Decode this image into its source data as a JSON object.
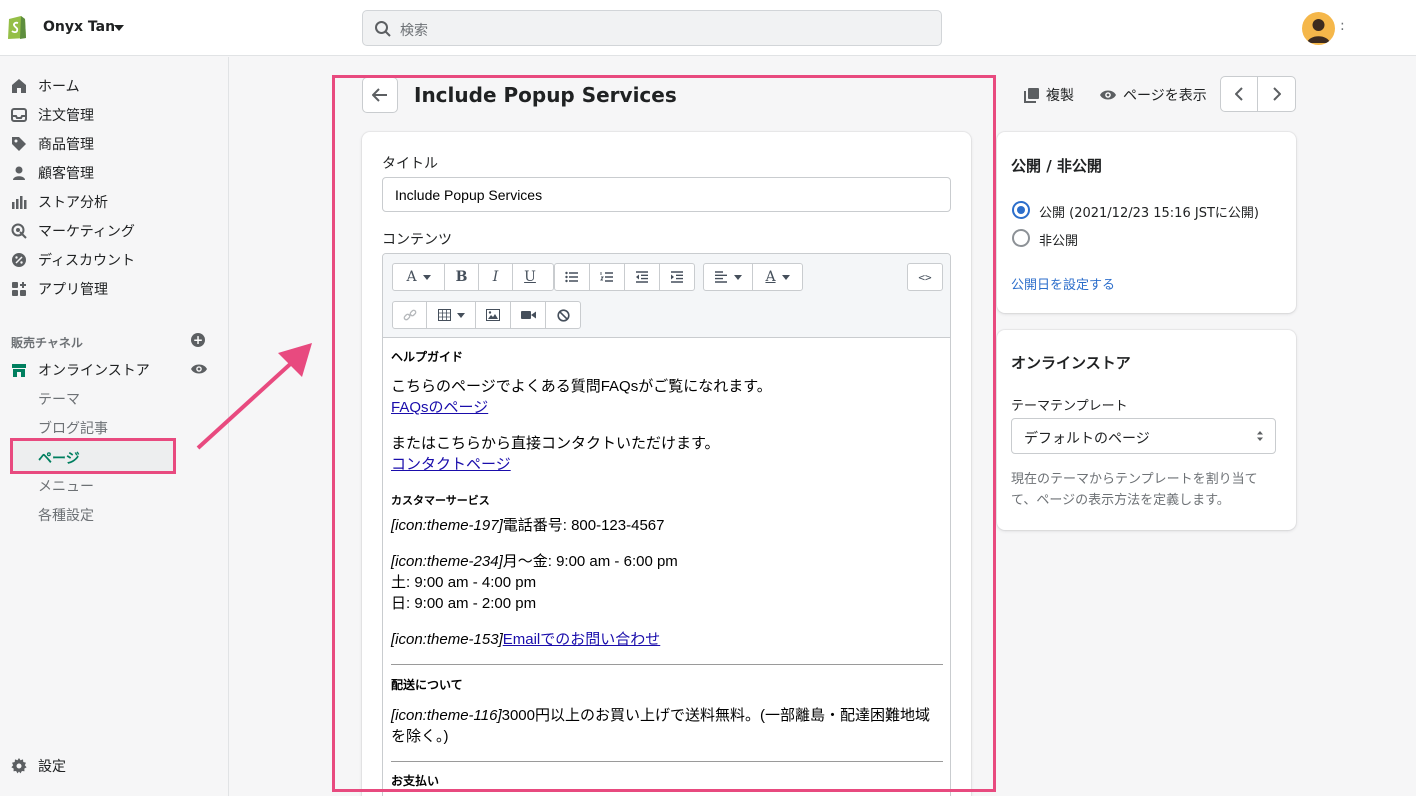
{
  "store": {
    "name": "Onyx Tan"
  },
  "search": {
    "placeholder": "検索"
  },
  "sidebar": {
    "items": [
      {
        "label": "ホーム"
      },
      {
        "label": "注文管理"
      },
      {
        "label": "商品管理"
      },
      {
        "label": "顧客管理"
      },
      {
        "label": "ストア分析"
      },
      {
        "label": "マーケティング"
      },
      {
        "label": "ディスカウント"
      },
      {
        "label": "アプリ管理"
      }
    ],
    "channels_heading": "販売チャネル",
    "online_store": "オンラインストア",
    "sub_items": [
      {
        "label": "テーマ"
      },
      {
        "label": "ブログ記事"
      },
      {
        "label": "ページ"
      },
      {
        "label": "メニュー"
      },
      {
        "label": "各種設定"
      }
    ],
    "settings": "設定"
  },
  "header": {
    "title": "Include Popup Services",
    "duplicate": "複製",
    "view_page": "ページを表示"
  },
  "form": {
    "title_label": "タイトル",
    "title_value": "Include Popup Services",
    "content_label": "コンテンツ"
  },
  "content": {
    "help_heading": "ヘルプガイド",
    "faq_text": "こちらのページでよくある質問FAQsがご覧になれます。",
    "faq_link": "FAQsのページ",
    "contact_text": "またはこちらから直接コンタクトいただけます。",
    "contact_link": "コンタクトページ",
    "cs_heading": "カスタマーサービス",
    "phone_icon": "[icon:theme-197]",
    "phone_text": "電話番号: 800-123-4567",
    "hours_icon": "[icon:theme-234]",
    "hours_1": "月〜金: 9:00 am - 6:00 pm",
    "hours_2": "土: 9:00 am - 4:00 pm",
    "hours_3": "日: 9:00 am - 2:00 pm",
    "email_icon": "[icon:theme-153]",
    "email_link": "Emailでのお問い合わせ",
    "shipping_heading": "配送について",
    "shipping_icon": "[icon:theme-116]",
    "shipping_text_1": "3000円以上のお買い上げで送料無料。(一部離島・配達困難地域",
    "shipping_text_2": "を除く。)",
    "payment_heading": "お支払い"
  },
  "visibility": {
    "title": "公開 / 非公開",
    "published": "公開 (2021/12/23 15:16 JSTに公開)",
    "hidden": "非公開",
    "set_date": "公開日を設定する"
  },
  "online_store_card": {
    "title": "オンラインストア",
    "template_label": "テーマテンプレート",
    "template_value": "デフォルトのページ",
    "help": "現在のテーマからテンプレートを割り当てて、ページの表示方法を定義します。"
  },
  "colors": {
    "accent": "#e84a7f",
    "link": "#2c6ecb",
    "brand": "#95bf47",
    "active": "#007f5f"
  }
}
